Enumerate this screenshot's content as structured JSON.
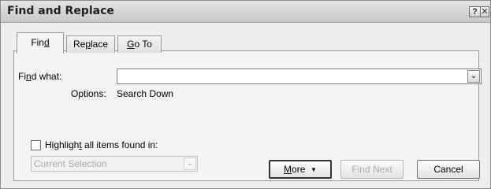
{
  "window": {
    "title": "Find and Replace",
    "help_glyph": "?",
    "close_glyph": "✕"
  },
  "tabs": [
    {
      "label_pre": "Fin",
      "label_u": "d",
      "label_post": "",
      "active": true
    },
    {
      "label_pre": "Re",
      "label_u": "p",
      "label_post": "lace",
      "active": false
    },
    {
      "label_pre": "",
      "label_u": "G",
      "label_post": "o To",
      "active": false
    }
  ],
  "find": {
    "label_pre": "Fi",
    "label_u": "n",
    "label_post": "d what:",
    "value": "",
    "dropdown_glyph": "⌄"
  },
  "options": {
    "label": "Options:",
    "value": "Search Down"
  },
  "highlight": {
    "checked": false,
    "label_pre": "Highligh",
    "label_u": "t",
    "label_post": " all items found in:"
  },
  "scope": {
    "selected": "Current Selection",
    "enabled": false,
    "dropdown_glyph": "⌄"
  },
  "buttons": {
    "more_pre": "",
    "more_u": "M",
    "more_post": "ore",
    "more_arrow": "▼",
    "find_next": "Find Next",
    "cancel": "Cancel"
  }
}
